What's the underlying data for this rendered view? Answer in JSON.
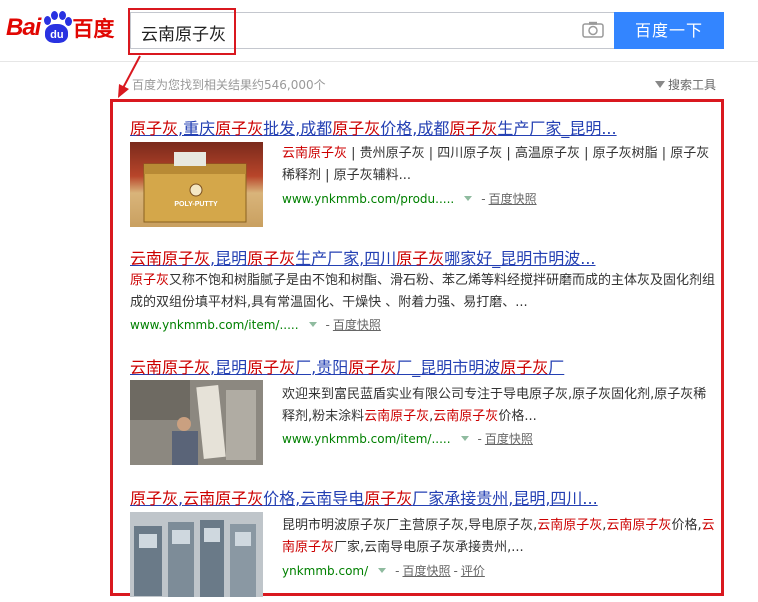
{
  "header": {
    "logo_bai": "Bai",
    "logo_du": "du",
    "logo_cn": "百度",
    "query": "云南原子灰",
    "search_button": "百度一下"
  },
  "info": {
    "result_count": "百度为您找到相关结果约546,000个",
    "tools_label": "搜索工具"
  },
  "results": [
    {
      "title_parts": [
        "原子灰",
        ",重庆",
        "原子灰",
        "批发,成都",
        "原子灰",
        "价格,成都",
        "原子灰",
        "生产厂家_昆明..."
      ],
      "abstract_parts": [
        "云南原子灰",
        " | 贵州原子灰 | 四川原子灰 | 高温原子灰 | 原子灰树脂 | 原子灰稀释剂 | 原子灰辅料..."
      ],
      "url": "www.ynkmmb.com/produ.....",
      "snapshot": "百度快照",
      "thumb_label": "POLY-PUTTY"
    },
    {
      "title_parts": [
        "云南原子灰",
        ",昆明",
        "原子灰",
        "生产厂家,四川",
        "原子灰",
        "哪家好_昆明市明波..."
      ],
      "abstract_parts": [
        "原子灰",
        "又称不饱和树脂腻子是由不饱和树酯、滑石粉、苯乙烯等料经搅拌研磨而成的主体灰及固化剂组成的双组份填平材料,具有常温固化、干燥快 、附着力强、易打磨、..."
      ],
      "url": "www.ynkmmb.com/item/.....",
      "snapshot": "百度快照"
    },
    {
      "title_parts": [
        "云南原子灰",
        ",昆明",
        "原子灰",
        "厂,贵阳",
        "原子灰",
        "厂_昆明市明波",
        "原子灰",
        "厂"
      ],
      "abstract_parts": [
        "欢迎来到富民蓝盾实业有限公司专注于导电原子灰,原子灰固化剂,原子灰稀释剂,粉末涂料",
        "云南原子灰",
        ",",
        "云南原子灰",
        "价格..."
      ],
      "url": "www.ynkmmb.com/item/.....",
      "snapshot": "百度快照"
    },
    {
      "title_parts": [
        "原子灰",
        ",",
        "云南原子灰",
        "价格,云南导电",
        "原子灰",
        "厂家承接贵州,昆明,四川..."
      ],
      "abstract_parts": [
        "昆明市明波原子灰厂主营原子灰,导电原子灰,",
        "云南原子灰",
        ",",
        "云南原子灰",
        "价格,",
        "云南原子灰",
        "厂家,云南导电原子灰承接贵州,..."
      ],
      "url": "ynkmmb.com/",
      "snapshot": "百度快照",
      "evaluate": "评价"
    }
  ],
  "colors": {
    "accent": "#3385ff",
    "highlight_box": "#d9181f",
    "link": "#2440b3",
    "keyword": "#cc0000",
    "url": "#008000"
  }
}
